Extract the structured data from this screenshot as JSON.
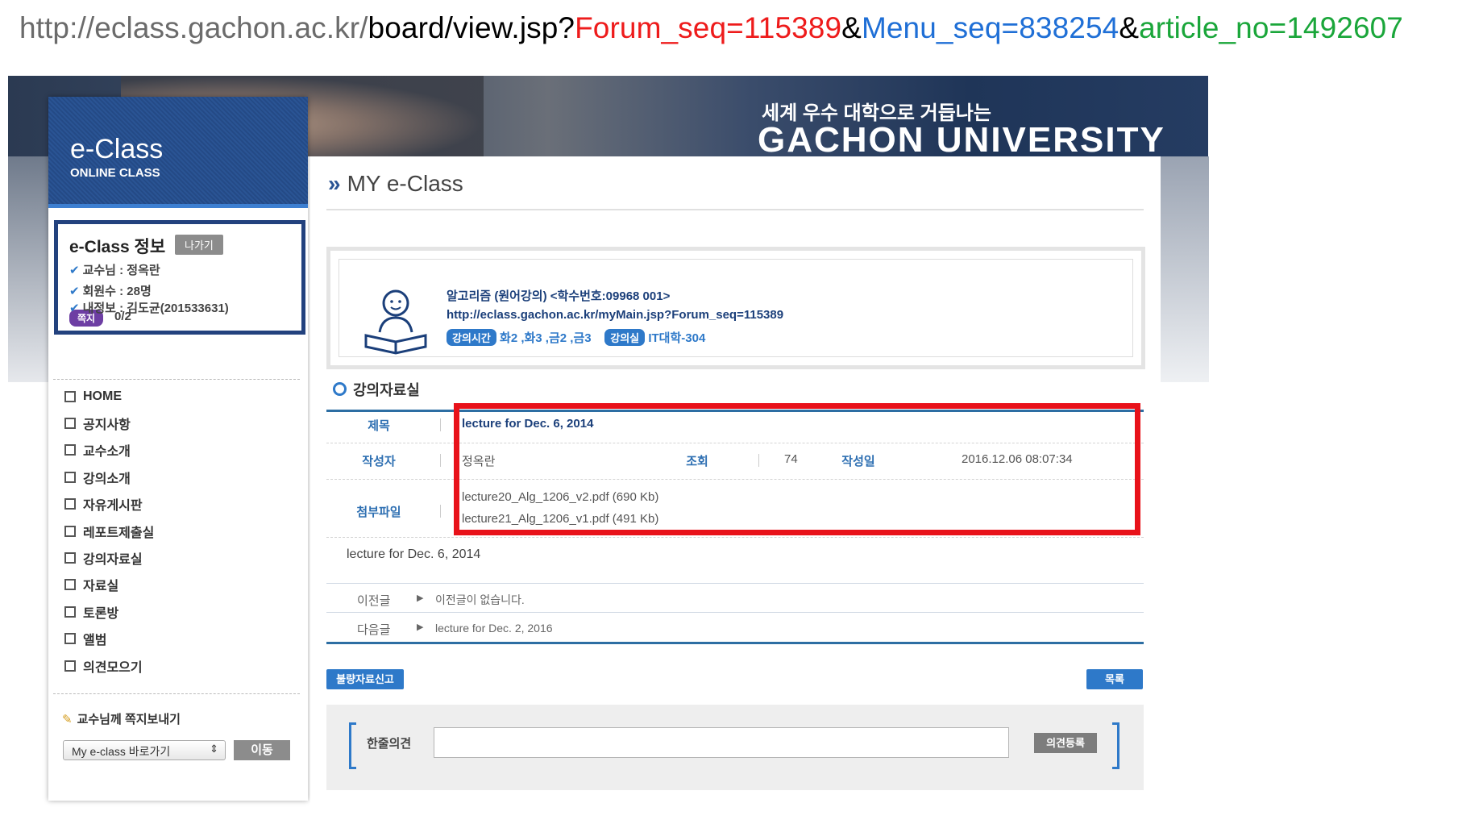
{
  "url": {
    "base": "http://eclass.gachon.ac.kr/",
    "path": "board/view.jsp?",
    "param1": "Forum_seq=115389",
    "amp": "&",
    "param2": "Menu_seq=838254",
    "param3": "article_no=1492607"
  },
  "banner": {
    "slogan": "세계 우수 대학으로 거듭나는",
    "university": "GACHON UNIVERSITY"
  },
  "sidebar": {
    "logo_title": "e-Class",
    "logo_subtitle": "ONLINE CLASS",
    "info": {
      "title": "e-Class 정보",
      "exit_label": "나가기",
      "professor": "교수님 : 정옥란",
      "members": "회원수 : 28명",
      "myinfo": "내정보 : 김도균(201533631)",
      "memo_label": "쪽지",
      "memo_count": "0/2"
    },
    "menu": [
      "HOME",
      "공지사항",
      "교수소개",
      "강의소개",
      "자유게시판",
      "레포트제출실",
      "강의자료실",
      "자료실",
      "토론방",
      "앨범",
      "의견모으기"
    ],
    "send_message": "교수님께 쪽지보내기",
    "shortcut_select": "My e-class 바로가기",
    "go_label": "이동"
  },
  "main": {
    "page_title": "MY e-Class",
    "course": {
      "name": "알고리즘 (원어강의) <학수번호:09968 001>",
      "link": "http://eclass.gachon.ac.kr/myMain.jsp?Forum_seq=115389",
      "time_badge": "강의시간",
      "time": "화2 ,화3 ,금2 ,금3",
      "room_badge": "강의실",
      "room": "IT대학-304"
    },
    "section_title": "강의자료실",
    "article": {
      "title_label": "제목",
      "title": "lecture for Dec. 6, 2014",
      "author_label": "작성자",
      "author": "정옥란",
      "views_label": "조회",
      "views": "74",
      "date_label": "작성일",
      "date": "2016.12.06 08:07:34",
      "attach_label": "첨부파일",
      "attachments": [
        "lecture20_Alg_1206_v2.pdf (690 Kb)",
        "lecture21_Alg_1206_v1.pdf (491 Kb)"
      ],
      "body": "lecture for Dec. 6, 2014"
    },
    "nav": {
      "prev_label": "이전글",
      "prev_text": "이전글이 없습니다.",
      "next_label": "다음글",
      "next_text": "lecture for Dec. 2, 2016"
    },
    "report_button": "불량자료신고",
    "list_button": "목록",
    "comment": {
      "label": "한줄의견",
      "value": "",
      "submit": "의견등록"
    }
  }
}
